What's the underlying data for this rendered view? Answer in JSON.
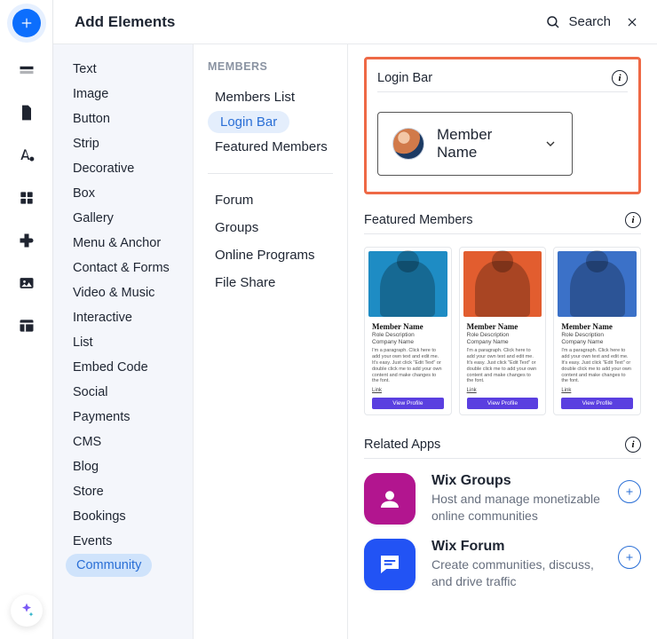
{
  "header": {
    "title": "Add Elements",
    "search_label": "Search"
  },
  "rail": {
    "icons": [
      "add",
      "section",
      "page",
      "text",
      "grid",
      "plugin",
      "image",
      "table"
    ]
  },
  "categories": [
    "Text",
    "Image",
    "Button",
    "Strip",
    "Decorative",
    "Box",
    "Gallery",
    "Menu & Anchor",
    "Contact & Forms",
    "Video & Music",
    "Interactive",
    "List",
    "Embed Code",
    "Social",
    "Payments",
    "CMS",
    "Blog",
    "Store",
    "Bookings",
    "Events",
    "Community"
  ],
  "categories_selected": "Community",
  "subnav": {
    "heading": "MEMBERS",
    "group1": [
      "Members List",
      "Login Bar",
      "Featured Members"
    ],
    "selected": "Login Bar",
    "group2": [
      "Forum",
      "Groups",
      "Online Programs",
      "File Share"
    ]
  },
  "sections": {
    "login_bar": {
      "title": "Login Bar",
      "widget_label": "Member Name"
    },
    "featured": {
      "title": "Featured Members",
      "card": {
        "name": "Member Name",
        "role": "Role Description",
        "company": "Company Name",
        "para": "I'm a paragraph. Click here to add your own text and edit me. It's easy. Just click \"Edit Text\" or double click me to add your own content and make changes to the font.",
        "link": "Link",
        "button": "View Profile"
      }
    },
    "related": {
      "title": "Related Apps",
      "apps": [
        {
          "name": "Wix Groups",
          "desc": "Host and manage monetizable online communities"
        },
        {
          "name": "Wix Forum",
          "desc": "Create communities, discuss, and drive traffic"
        }
      ]
    }
  }
}
